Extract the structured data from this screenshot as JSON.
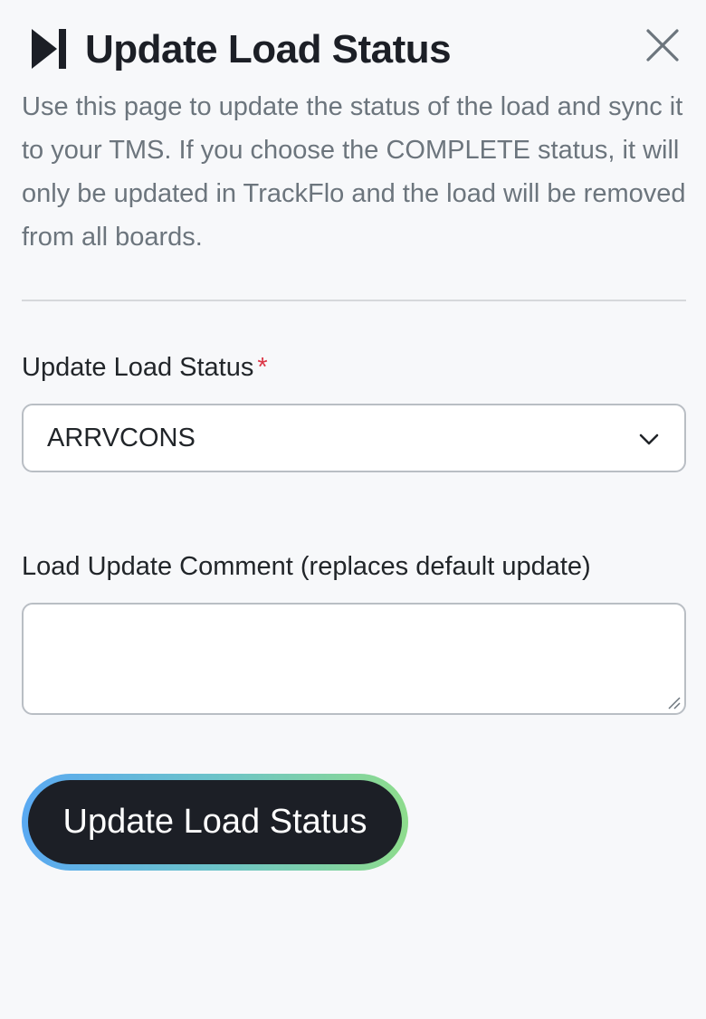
{
  "header": {
    "title": "Update Load Status",
    "icon": "skip-forward-icon",
    "close_icon": "close-icon"
  },
  "intro": {
    "text": "Use this page to update the status of the load and sync it to your TMS. If you choose the COMPLETE status, it will only be updated in TrackFlo and the load will be removed from all boards."
  },
  "status_field": {
    "label": "Update Load Status",
    "required_marker": "*",
    "selected_value": "ARRVCONS"
  },
  "comment_field": {
    "label": "Load Update Comment (replaces default update)",
    "value": ""
  },
  "submit": {
    "label": "Update Load Status"
  },
  "colors": {
    "title": "#1c1f26",
    "body_text": "#6c757d",
    "required": "#dc3545",
    "button_bg": "#1c1f26",
    "gradient_start": "#5aa9f2",
    "gradient_end": "#8edc8c"
  }
}
